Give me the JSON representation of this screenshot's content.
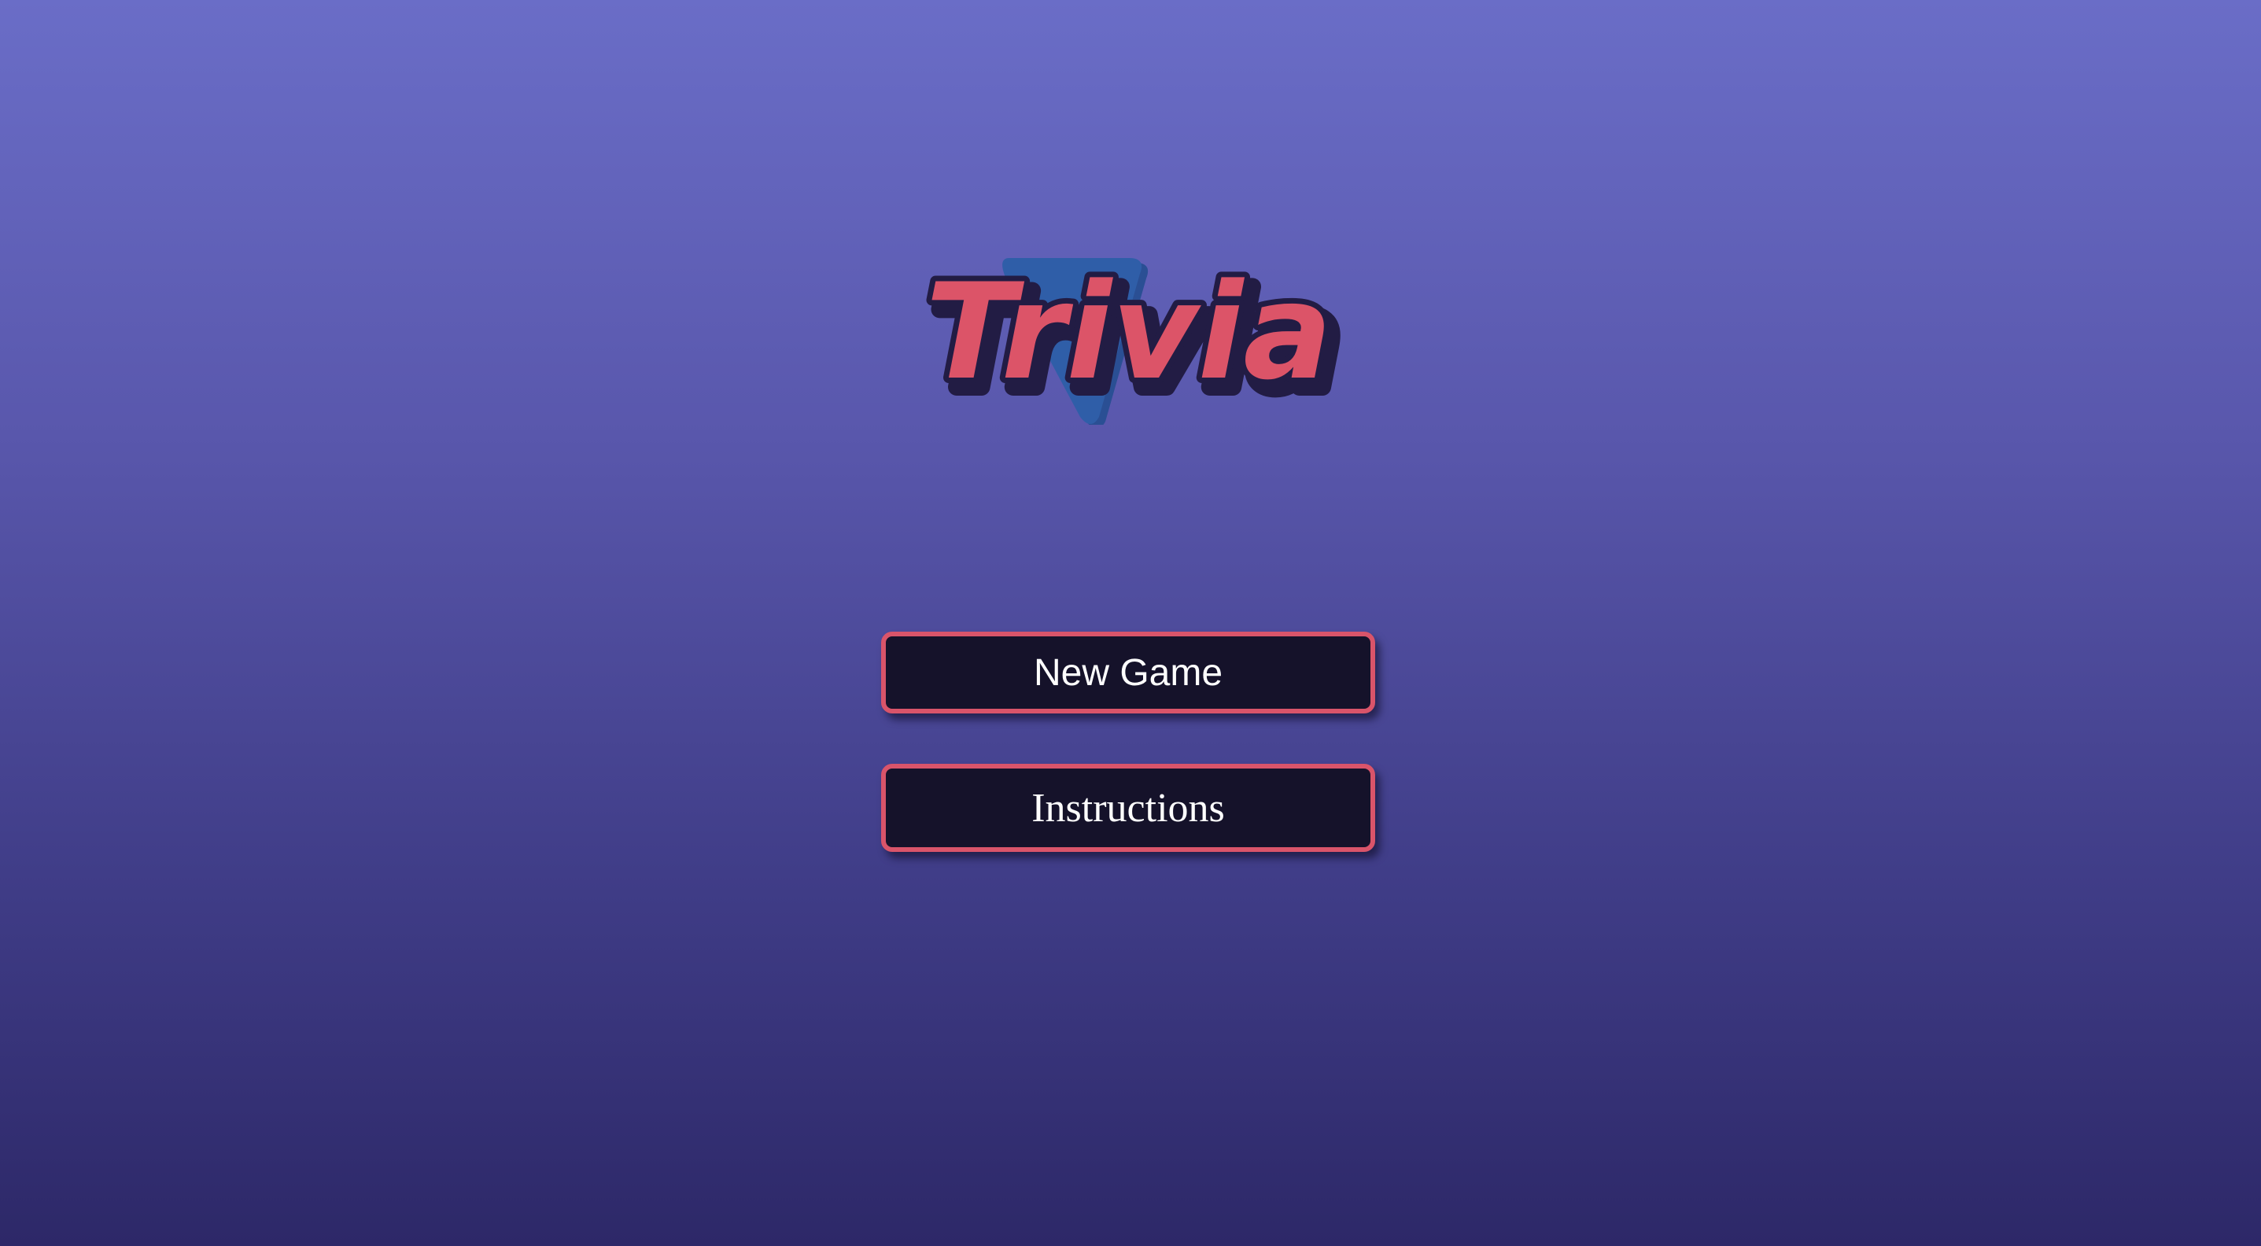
{
  "logo": {
    "text": "Trivia",
    "colors": {
      "letters": "#dc5468",
      "letter_outline": "#221c44",
      "triangle": "#2f5ea8"
    }
  },
  "menu": {
    "new_game_label": "New Game",
    "instructions_label": "Instructions"
  },
  "theme": {
    "background_top": "#6a6dc7",
    "background_bottom": "#2d2868",
    "button_fill": "#15122a",
    "button_border": "#d9546a",
    "button_text": "#ffffff"
  }
}
